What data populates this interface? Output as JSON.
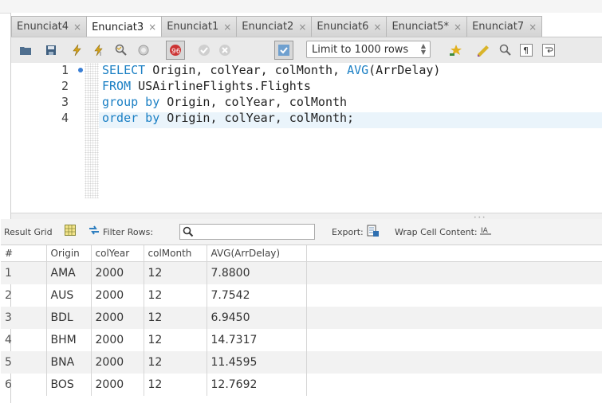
{
  "tabs": [
    {
      "label": "Enunciat4",
      "active": false
    },
    {
      "label": "Enunciat3",
      "active": true
    },
    {
      "label": "Enunciat1",
      "active": false
    },
    {
      "label": "Enunciat2",
      "active": false
    },
    {
      "label": "Enunciat6",
      "active": false
    },
    {
      "label": "Enunciat5*",
      "active": false
    },
    {
      "label": "Enunciat7",
      "active": false
    }
  ],
  "toolbar": {
    "limit_label": "Limit to 1000 rows",
    "icons": [
      "open-folder-icon",
      "save-icon",
      "execute-icon",
      "execute-current-icon",
      "explain-icon",
      "stop-icon",
      "toggle-error-icon",
      "commit-icon",
      "rollback-icon",
      "autocommit-icon",
      "beautify-icon",
      "snippet-icon",
      "find-icon",
      "invisible-chars-icon",
      "wrap-icon"
    ]
  },
  "editor": {
    "line_numbers": [
      "1",
      "2",
      "3",
      "4"
    ],
    "lines": [
      {
        "kw": "SELECT",
        "rest": " Origin, colYear, colMonth, ",
        "fn": "AVG",
        "tail": "(ArrDelay)"
      },
      {
        "kw": "FROM",
        "rest": " USAirlineFlights.Flights"
      },
      {
        "kw": "group by",
        "rest": " Origin, colYear, colMonth"
      },
      {
        "kw": "order by",
        "rest": " Origin, colYear, colMonth;"
      }
    ]
  },
  "result_toolbar": {
    "result_grid": "Result Grid",
    "filter_rows": "Filter Rows:",
    "export": "Export:",
    "wrap": "Wrap Cell Content:"
  },
  "grid": {
    "columns": [
      "#",
      "Origin",
      "colYear",
      "colMonth",
      "AVG(ArrDelay)"
    ],
    "rows": [
      [
        "1",
        "AMA",
        "2000",
        "12",
        "7.8800"
      ],
      [
        "2",
        "AUS",
        "2000",
        "12",
        "7.7542"
      ],
      [
        "3",
        "BDL",
        "2000",
        "12",
        "6.9450"
      ],
      [
        "4",
        "BHM",
        "2000",
        "12",
        "14.7317"
      ],
      [
        "5",
        "BNA",
        "2000",
        "12",
        "11.4595"
      ],
      [
        "6",
        "BOS",
        "2000",
        "12",
        "12.7692"
      ]
    ]
  },
  "colors": {
    "keyword": "#1a7fc4",
    "current_line": "#eaf4fb"
  }
}
